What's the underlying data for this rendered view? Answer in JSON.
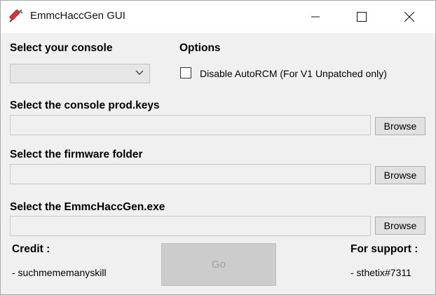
{
  "window": {
    "title": "EmmcHaccGen GUI"
  },
  "console": {
    "label": "Select your console",
    "selected": ""
  },
  "options": {
    "label": "Options",
    "disable_autorcm": {
      "label": "Disable AutoRCM (For V1 Unpatched only)",
      "checked": false
    }
  },
  "prodkeys": {
    "label": "Select the console prod.keys",
    "value": "",
    "browse": "Browse"
  },
  "firmware": {
    "label": "Select the firmware folder",
    "value": "",
    "browse": "Browse"
  },
  "exe": {
    "label": "Select the EmmcHaccGen.exe",
    "value": "",
    "browse": "Browse"
  },
  "credit": {
    "label": "Credit :",
    "value": "- suchmememanyskill"
  },
  "support": {
    "label": "For support :",
    "value": "- sthetix#7311"
  },
  "go": {
    "label": "Go",
    "enabled": false
  }
}
